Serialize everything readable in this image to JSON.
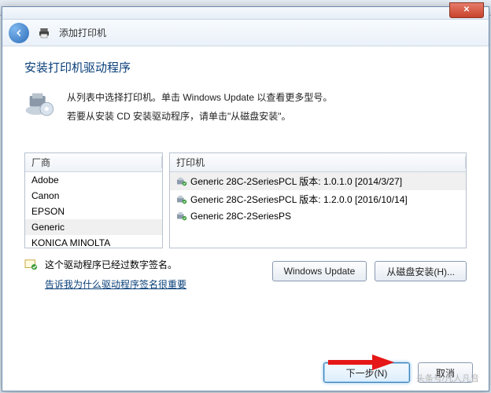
{
  "header": {
    "title": "添加打印机"
  },
  "closeGlyph": "✕",
  "page": {
    "heading": "安装打印机驱动程序",
    "line1": "从列表中选择打印机。单击 Windows Update 以查看更多型号。",
    "line2": "若要从安装 CD 安装驱动程序，请单击\"从磁盘安装\"。"
  },
  "manufacturer": {
    "header": "厂商",
    "items": [
      "Adobe",
      "Canon",
      "EPSON",
      "Generic",
      "KONICA MINOLTA"
    ],
    "selectedIndex": 3
  },
  "printers": {
    "header": "打印机",
    "items": [
      "Generic 28C-2SeriesPCL 版本: 1.0.1.0 [2014/3/27]",
      "Generic 28C-2SeriesPCL 版本: 1.2.0.0 [2016/10/14]",
      "Generic 28C-2SeriesPS"
    ],
    "selectedIndex": 0
  },
  "signature": {
    "text": "这个驱动程序已经过数字签名。",
    "link": "告诉我为什么驱动程序签名很重要"
  },
  "buttons": {
    "windows_update": "Windows Update",
    "from_disk": "从磁盘安装(H)...",
    "next": "下一步(N)",
    "cancel": "取消"
  },
  "watermark": "头条号/凡人凡音"
}
